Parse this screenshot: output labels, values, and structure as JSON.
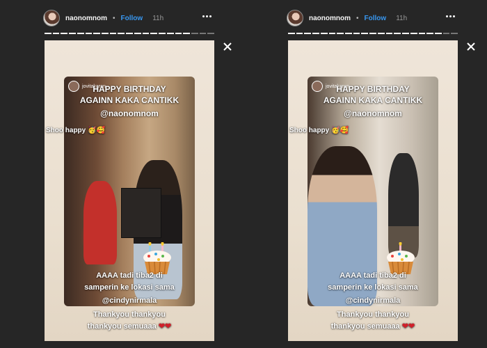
{
  "stories": [
    {
      "header": {
        "username": "naonomnom",
        "separator": "•",
        "follow_label": "Follow",
        "time": "11h"
      },
      "sticker_user": "jovitakaren",
      "caption_title_lines": [
        "HAPPY BIRTHDAY",
        "AGAINN KAKA CANTIKK"
      ],
      "mention_top": "@naonomnom",
      "shoo_text": "Shoo happy",
      "shoo_emoji": "🥳🥰",
      "body_lines": [
        "AAAA tadi tiba2 di",
        "samperin ke lokasi sama"
      ],
      "mention_bottom": "@cindynirmala",
      "thanks_lines": [
        "Thankyou thankyou",
        "thankyou semuaaa"
      ],
      "hearts": "❤❤",
      "progress_done": 18,
      "progress_pending": 3
    },
    {
      "header": {
        "username": "naonomnom",
        "separator": "•",
        "follow_label": "Follow",
        "time": "11h"
      },
      "sticker_user": "jovitakaren",
      "caption_title_lines": [
        "HAPPY BIRTHDAY",
        "AGAINN KAKA CANTIKK"
      ],
      "mention_top": "@naonomnom",
      "shoo_text": "Shoo happy",
      "shoo_emoji": "🥳🥰",
      "body_lines": [
        "AAAA tadi tiba2 di",
        "samperin ke lokasi sama"
      ],
      "mention_bottom": "@cindynirmala",
      "thanks_lines": [
        "Thankyou thankyou",
        "thankyou semuaaa"
      ],
      "hearts": "❤❤",
      "progress_done": 19,
      "progress_pending": 2
    }
  ],
  "icons": {
    "more": "more-horizontal-icon",
    "close": "close-icon",
    "cupcake": "birthday-cupcake-icon"
  },
  "colors": {
    "background": "#262626",
    "follow": "#3897f0",
    "heart": "#d0202a"
  }
}
